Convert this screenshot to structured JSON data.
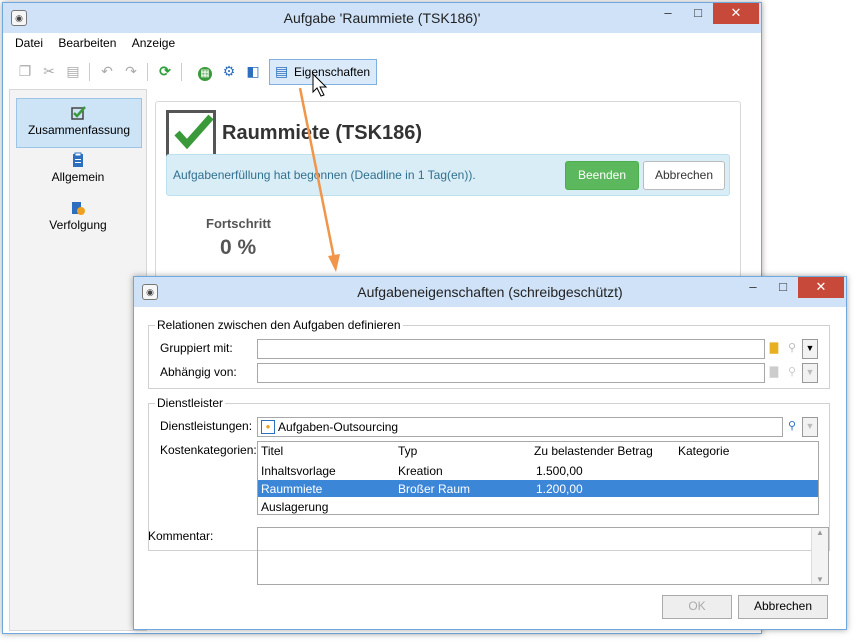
{
  "main_window": {
    "title": "Aufgabe 'Raummiete (TSK186)'",
    "menu": [
      "Datei",
      "Bearbeiten",
      "Anzeige"
    ],
    "toolbar": {
      "properties_label": "Eigenschaften"
    },
    "sidebar": {
      "items": [
        {
          "label": "Zusammenfassung",
          "icon": "check-icon"
        },
        {
          "label": "Allgemein",
          "icon": "clipboard-icon"
        },
        {
          "label": "Verfolgung",
          "icon": "tracking-icon"
        }
      ]
    },
    "summary": {
      "task_title": "Raummiete (TSK186)",
      "alert_text": "Aufgabenerfüllung hat begonnen (Deadline in 1 Tag(en)).",
      "finish_label": "Beenden",
      "cancel_label": "Abbrechen",
      "progress_label": "Fortschritt",
      "progress_value": "0 %"
    }
  },
  "dialog": {
    "title": "Aufgabeneigenschaften (schreibgeschützt)",
    "relations": {
      "legend": "Relationen zwischen den Aufgaben definieren",
      "grouped_label": "Gruppiert mit:",
      "grouped_value": "",
      "depends_label": "Abhängig von:",
      "depends_value": ""
    },
    "provider": {
      "legend": "Dienstleister",
      "services_label": "Dienstleistungen:",
      "services_value": "Aufgaben-Outsourcing",
      "cost_label": "Kostenkategorien:",
      "columns": [
        "Titel",
        "Typ",
        "Zu belastender Betrag",
        "Kategorie"
      ],
      "rows": [
        {
          "title": "Inhaltsvorlage",
          "type": "Kreation",
          "amount": "1.500,00",
          "category": ""
        },
        {
          "title": "Raummiete",
          "type": "Broßer Raum",
          "amount": "1.200,00",
          "category": ""
        },
        {
          "title": "Auslagerung",
          "type": "",
          "amount": "",
          "category": ""
        }
      ],
      "selected_row": 1
    },
    "comment_label": "Kommentar:",
    "comment_value": "",
    "ok_label": "OK",
    "cancel_label": "Abbrechen"
  },
  "colors": {
    "accent": "#3c86d8",
    "success": "#5cb85c",
    "alert_bg": "#d9edf7",
    "arrow": "#f0954a",
    "close": "#c7493a"
  }
}
